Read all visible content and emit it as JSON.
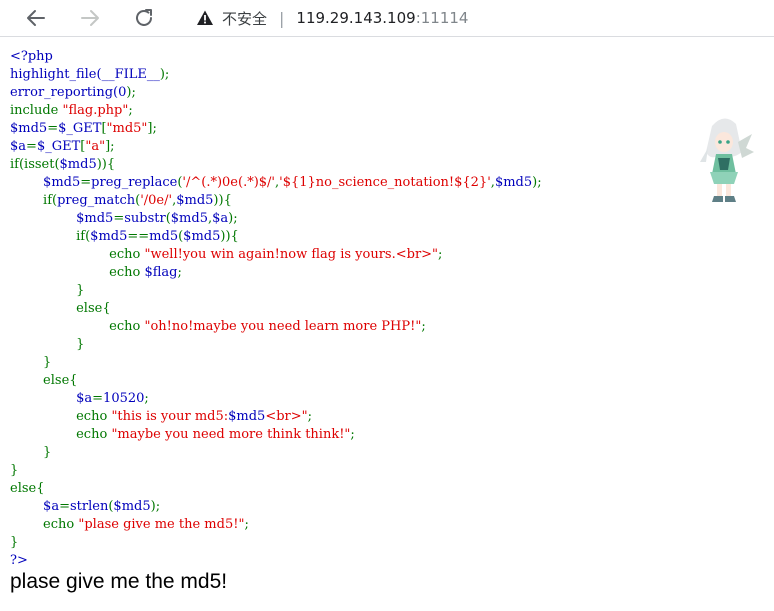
{
  "browser": {
    "security_label": "不安全",
    "separator": "|",
    "url_host": "119.29.143.109",
    "url_port": ":11114"
  },
  "code_lines": [
    [
      {
        "c": "d",
        "t": "<?php"
      }
    ],
    [
      {
        "c": "d",
        "t": "highlight_file("
      },
      {
        "c": "d",
        "t": "__FILE__"
      },
      {
        "c": "k",
        "t": ");"
      }
    ],
    [
      {
        "c": "d",
        "t": "error_reporting("
      },
      {
        "c": "d",
        "t": "0"
      },
      {
        "c": "k",
        "t": ");"
      }
    ],
    [
      {
        "c": "k",
        "t": "include "
      },
      {
        "c": "s",
        "t": "\"flag.php\""
      },
      {
        "c": "k",
        "t": ";"
      }
    ],
    [
      {
        "c": "d",
        "t": "$md5"
      },
      {
        "c": "k",
        "t": "="
      },
      {
        "c": "d",
        "t": "$_GET"
      },
      {
        "c": "k",
        "t": "["
      },
      {
        "c": "s",
        "t": "\"md5\""
      },
      {
        "c": "k",
        "t": "];"
      }
    ],
    [
      {
        "c": "d",
        "t": "$a"
      },
      {
        "c": "k",
        "t": "="
      },
      {
        "c": "d",
        "t": "$_GET"
      },
      {
        "c": "k",
        "t": "["
      },
      {
        "c": "s",
        "t": "\"a\""
      },
      {
        "c": "k",
        "t": "];"
      }
    ],
    [
      {
        "c": "k",
        "t": "if(isset("
      },
      {
        "c": "d",
        "t": "$md5"
      },
      {
        "c": "k",
        "t": ")){"
      }
    ],
    [
      {
        "c": "d",
        "t": "        $md5"
      },
      {
        "c": "k",
        "t": "="
      },
      {
        "c": "d",
        "t": "preg_replace"
      },
      {
        "c": "k",
        "t": "("
      },
      {
        "c": "s",
        "t": "'/^(.*)0e(.*)$/'"
      },
      {
        "c": "k",
        "t": ","
      },
      {
        "c": "s",
        "t": "'${1}no_science_notation!${2}'"
      },
      {
        "c": "k",
        "t": ","
      },
      {
        "c": "d",
        "t": "$md5"
      },
      {
        "c": "k",
        "t": ");"
      }
    ],
    [
      {
        "c": "k",
        "t": "        if("
      },
      {
        "c": "d",
        "t": "preg_match"
      },
      {
        "c": "k",
        "t": "("
      },
      {
        "c": "s",
        "t": "'/0e/'"
      },
      {
        "c": "k",
        "t": ","
      },
      {
        "c": "d",
        "t": "$md5"
      },
      {
        "c": "k",
        "t": ")){"
      }
    ],
    [
      {
        "c": "d",
        "t": "                $md5"
      },
      {
        "c": "k",
        "t": "="
      },
      {
        "c": "d",
        "t": "substr"
      },
      {
        "c": "k",
        "t": "("
      },
      {
        "c": "d",
        "t": "$md5"
      },
      {
        "c": "k",
        "t": ","
      },
      {
        "c": "d",
        "t": "$a"
      },
      {
        "c": "k",
        "t": ");"
      }
    ],
    [
      {
        "c": "k",
        "t": "                if("
      },
      {
        "c": "d",
        "t": "$md5"
      },
      {
        "c": "k",
        "t": "=="
      },
      {
        "c": "d",
        "t": "md5"
      },
      {
        "c": "k",
        "t": "("
      },
      {
        "c": "d",
        "t": "$md5"
      },
      {
        "c": "k",
        "t": ")){"
      }
    ],
    [
      {
        "c": "k",
        "t": "                        echo "
      },
      {
        "c": "s",
        "t": "\"well!you win again!now flag is yours.<br>\""
      },
      {
        "c": "k",
        "t": ";"
      }
    ],
    [
      {
        "c": "k",
        "t": "                        echo "
      },
      {
        "c": "d",
        "t": "$flag"
      },
      {
        "c": "k",
        "t": ";"
      }
    ],
    [
      {
        "c": "k",
        "t": "                }"
      }
    ],
    [
      {
        "c": "k",
        "t": "                else{"
      }
    ],
    [
      {
        "c": "k",
        "t": "                        echo "
      },
      {
        "c": "s",
        "t": "\"oh!no!maybe you need learn more PHP!\""
      },
      {
        "c": "k",
        "t": ";"
      }
    ],
    [
      {
        "c": "k",
        "t": "                }"
      }
    ],
    [
      {
        "c": "k",
        "t": "        }"
      }
    ],
    [
      {
        "c": "k",
        "t": "        else{"
      }
    ],
    [
      {
        "c": "d",
        "t": "                $a"
      },
      {
        "c": "k",
        "t": "="
      },
      {
        "c": "d",
        "t": "10520"
      },
      {
        "c": "k",
        "t": ";"
      }
    ],
    [
      {
        "c": "k",
        "t": "                echo "
      },
      {
        "c": "s",
        "t": "\"this is your md5:"
      },
      {
        "c": "d",
        "t": "$md5"
      },
      {
        "c": "s",
        "t": "<br>\""
      },
      {
        "c": "k",
        "t": ";"
      }
    ],
    [
      {
        "c": "k",
        "t": "                echo "
      },
      {
        "c": "s",
        "t": "\"maybe you need more think think!\""
      },
      {
        "c": "k",
        "t": ";"
      }
    ],
    [
      {
        "c": "k",
        "t": "        }"
      }
    ],
    [
      {
        "c": "k",
        "t": "}"
      }
    ],
    [
      {
        "c": "k",
        "t": "else{"
      }
    ],
    [
      {
        "c": "d",
        "t": "        $a"
      },
      {
        "c": "k",
        "t": "="
      },
      {
        "c": "d",
        "t": "strlen"
      },
      {
        "c": "k",
        "t": "("
      },
      {
        "c": "d",
        "t": "$md5"
      },
      {
        "c": "k",
        "t": ");"
      }
    ],
    [
      {
        "c": "k",
        "t": "        echo "
      },
      {
        "c": "s",
        "t": "\"plase give me the md5!\""
      },
      {
        "c": "k",
        "t": ";"
      }
    ],
    [
      {
        "c": "k",
        "t": "}"
      }
    ],
    [
      {
        "c": "d",
        "t": "?>"
      }
    ]
  ],
  "output_text": "plase give me the md5!",
  "icons": {
    "back": "arrow-left-icon",
    "forward": "arrow-right-icon",
    "reload": "reload-icon",
    "warning": "warning-icon",
    "mascot": "anime-girl-mascot"
  },
  "colors": {
    "php_default": "#0000BB",
    "php_keyword": "#007700",
    "php_string": "#DD0000"
  }
}
